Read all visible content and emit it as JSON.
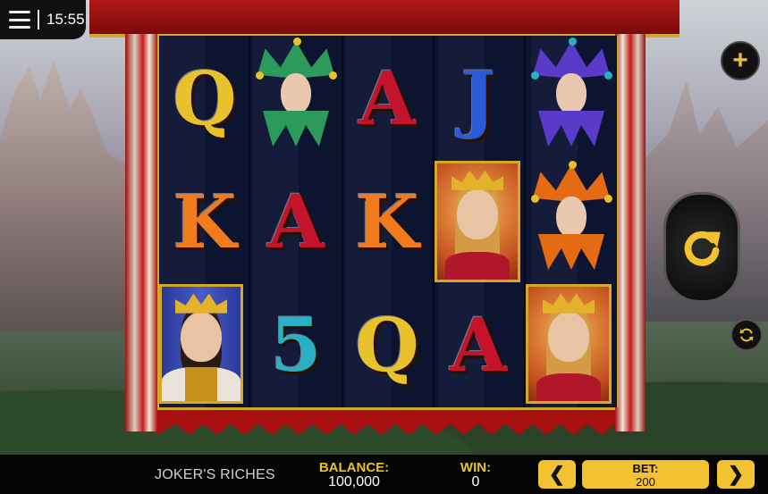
{
  "status": {
    "time": "15:55"
  },
  "reels": [
    [
      "Q",
      "K",
      "king"
    ],
    [
      "jester-green",
      "A",
      "5"
    ],
    [
      "A",
      "K",
      "Q"
    ],
    [
      "J",
      "queen",
      "A"
    ],
    [
      "jester-purple",
      "jester-orange",
      "queen"
    ]
  ],
  "colors": {
    "gold": "#e8c22c",
    "red": "#c4142c",
    "blue": "#2a5ad8",
    "orange": "#f07a1c",
    "teal": "#2ab0c4"
  },
  "controls": {
    "menu_icon": "hamburger-icon",
    "plus_icon": "plus-icon",
    "spin_icon": "spin-icon",
    "autoplay_icon": "autoplay-icon"
  },
  "bottom_bar": {
    "game_name": "JOKER'S RICHES",
    "balance_label": "BALANCE:",
    "balance_value": "100,000",
    "win_label": "WIN:",
    "win_value": "0",
    "bet_label": "BET:",
    "bet_value": "200",
    "prev_label": "❮",
    "next_label": "❯"
  }
}
